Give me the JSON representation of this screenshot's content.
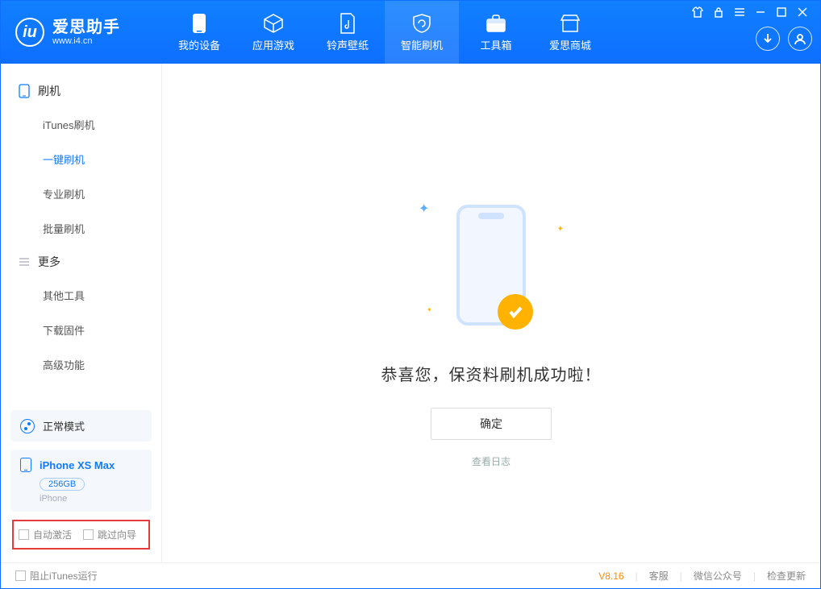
{
  "app": {
    "title": "爱思助手",
    "subtitle": "www.i4.cn"
  },
  "nav": {
    "items": [
      {
        "label": "我的设备"
      },
      {
        "label": "应用游戏"
      },
      {
        "label": "铃声壁纸"
      },
      {
        "label": "智能刷机"
      },
      {
        "label": "工具箱"
      },
      {
        "label": "爱思商城"
      }
    ]
  },
  "sidebar": {
    "group1": {
      "title": "刷机",
      "items": [
        "iTunes刷机",
        "一键刷机",
        "专业刷机",
        "批量刷机"
      ]
    },
    "group2": {
      "title": "更多",
      "items": [
        "其他工具",
        "下载固件",
        "高级功能"
      ]
    },
    "mode": {
      "label": "正常模式"
    },
    "device": {
      "name": "iPhone XS Max",
      "storage": "256GB",
      "type": "iPhone"
    },
    "checkboxes": {
      "auto_activate": "自动激活",
      "skip_guide": "跳过向导"
    }
  },
  "main": {
    "success_text": "恭喜您，保资料刷机成功啦！",
    "ok_button": "确定",
    "view_log": "查看日志"
  },
  "statusbar": {
    "block_itunes": "阻止iTunes运行",
    "version": "V8.16",
    "support": "客服",
    "wechat": "微信公众号",
    "update": "检查更新"
  }
}
